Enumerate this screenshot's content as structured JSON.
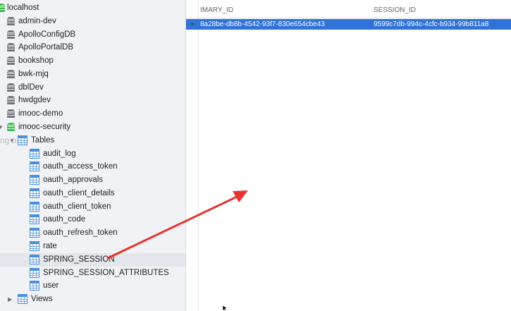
{
  "sidebar": {
    "connection": "localhost",
    "databases": [
      "admin-dev",
      "ApolloConfigDB",
      "ApolloPortalDB",
      "bookshop",
      "bwk-mjq",
      "dblDev",
      "hwdgdev",
      "imooc-demo",
      "imooc-security"
    ],
    "tables_label": "Tables",
    "tables": [
      "audit_log",
      "oauth_access_token",
      "oauth_approvals",
      "oauth_client_details",
      "oauth_client_token",
      "oauth_code",
      "oauth_refresh_token",
      "rate",
      "SPRING_SESSION",
      "SPRING_SESSION_ATTRIBUTES",
      "user"
    ],
    "views_label": "Views",
    "ghost_text": "ng o"
  },
  "grid": {
    "columns": [
      "IMARY_ID",
      "SESSION_ID"
    ],
    "rows": [
      [
        "8a28be-db8b-4542-93f7-830e654cbe43",
        "9599c7db-994c-4cfc-b934-99b811a8"
      ]
    ]
  },
  "colors": {
    "selection": "#2f72d8",
    "sidebar_bg": "#f0f2f5",
    "db_icon": "#6f7377",
    "active_db_icon": "#3dbb4c",
    "table_icon": "#4a8fd9",
    "annotation_arrow": "#e8322e"
  }
}
